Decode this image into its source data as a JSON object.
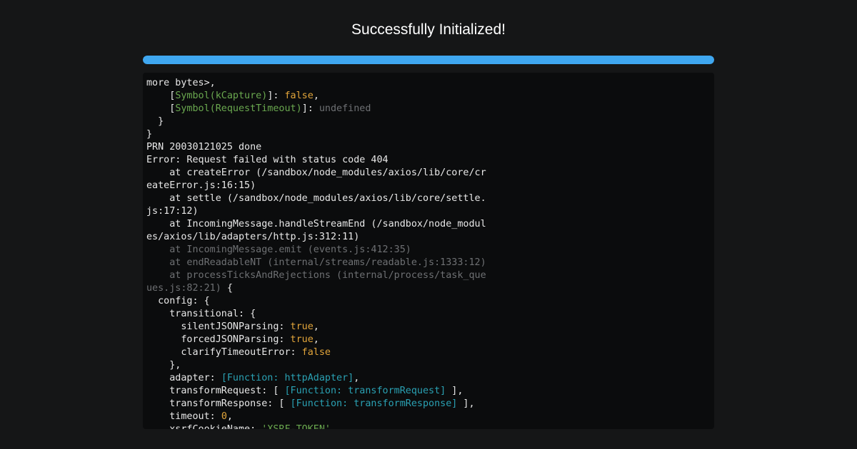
{
  "page": {
    "title": "Successfully Initialized!"
  },
  "progress": {
    "value_percent": 100,
    "color": "#3fa7f0"
  },
  "colors": {
    "background": "#151617",
    "console_background": "#0b0c0d",
    "text": "#e8e8e8",
    "green": "#6aa84f",
    "orange": "#e2a53a",
    "dim": "#6e7073",
    "cyan": "#2aa1b3"
  },
  "console": {
    "lines": [
      [
        {
          "t": "more bytes>,",
          "c": "default"
        }
      ],
      [
        {
          "t": "    ",
          "c": "default"
        },
        {
          "t": "[",
          "c": "default"
        },
        {
          "t": "Symbol(kCapture)",
          "c": "green"
        },
        {
          "t": "]: ",
          "c": "default"
        },
        {
          "t": "false",
          "c": "orange"
        },
        {
          "t": ",",
          "c": "default"
        }
      ],
      [
        {
          "t": "    ",
          "c": "default"
        },
        {
          "t": "[",
          "c": "default"
        },
        {
          "t": "Symbol(RequestTimeout)",
          "c": "green"
        },
        {
          "t": "]: ",
          "c": "default"
        },
        {
          "t": "undefined",
          "c": "dim"
        }
      ],
      [
        {
          "t": "  }",
          "c": "default"
        }
      ],
      [
        {
          "t": "}",
          "c": "default"
        }
      ],
      [
        {
          "t": "PRN 20030121025 done",
          "c": "default"
        }
      ],
      [
        {
          "t": "Error: Request failed with status code 404",
          "c": "default"
        }
      ],
      [
        {
          "t": "    at createError (/sandbox/node_modules/axios/lib/core/cr",
          "c": "default"
        }
      ],
      [
        {
          "t": "eateError.js:16:15)",
          "c": "default"
        }
      ],
      [
        {
          "t": "    at settle (/sandbox/node_modules/axios/lib/core/settle.",
          "c": "default"
        }
      ],
      [
        {
          "t": "js:17:12)",
          "c": "default"
        }
      ],
      [
        {
          "t": "    at IncomingMessage.handleStreamEnd (/sandbox/node_modul",
          "c": "default"
        }
      ],
      [
        {
          "t": "es/axios/lib/adapters/http.js:312:11)",
          "c": "default"
        }
      ],
      [
        {
          "t": "    at IncomingMessage.emit (events.js:412:35)",
          "c": "dim"
        }
      ],
      [
        {
          "t": "    at endReadableNT (internal/streams/readable.js:1333:12)",
          "c": "dim"
        }
      ],
      [
        {
          "t": "    at processTicksAndRejections (internal/process/task_que",
          "c": "dim"
        }
      ],
      [
        {
          "t": "ues.js:82:21)",
          "c": "dim"
        },
        {
          "t": " {",
          "c": "default"
        }
      ],
      [
        {
          "t": "  config: {",
          "c": "default"
        }
      ],
      [
        {
          "t": "    transitional: {",
          "c": "default"
        }
      ],
      [
        {
          "t": "      silentJSONParsing: ",
          "c": "default"
        },
        {
          "t": "true",
          "c": "orange"
        },
        {
          "t": ",",
          "c": "default"
        }
      ],
      [
        {
          "t": "      forcedJSONParsing: ",
          "c": "default"
        },
        {
          "t": "true",
          "c": "orange"
        },
        {
          "t": ",",
          "c": "default"
        }
      ],
      [
        {
          "t": "      clarifyTimeoutError: ",
          "c": "default"
        },
        {
          "t": "false",
          "c": "orange"
        }
      ],
      [
        {
          "t": "    },",
          "c": "default"
        }
      ],
      [
        {
          "t": "    adapter: ",
          "c": "default"
        },
        {
          "t": "[Function: httpAdapter]",
          "c": "cyan"
        },
        {
          "t": ",",
          "c": "default"
        }
      ],
      [
        {
          "t": "    transformRequest: [ ",
          "c": "default"
        },
        {
          "t": "[Function: transformRequest]",
          "c": "cyan"
        },
        {
          "t": " ],",
          "c": "default"
        }
      ],
      [
        {
          "t": "    transformResponse: [ ",
          "c": "default"
        },
        {
          "t": "[Function: transformResponse]",
          "c": "cyan"
        },
        {
          "t": " ],",
          "c": "default"
        }
      ],
      [
        {
          "t": "    timeout: ",
          "c": "default"
        },
        {
          "t": "0",
          "c": "orange"
        },
        {
          "t": ",",
          "c": "default"
        }
      ],
      [
        {
          "t": "    xsrfCookieName: ",
          "c": "default"
        },
        {
          "t": "'XSRF-TOKEN'",
          "c": "green"
        },
        {
          "t": ",",
          "c": "default"
        }
      ]
    ]
  }
}
